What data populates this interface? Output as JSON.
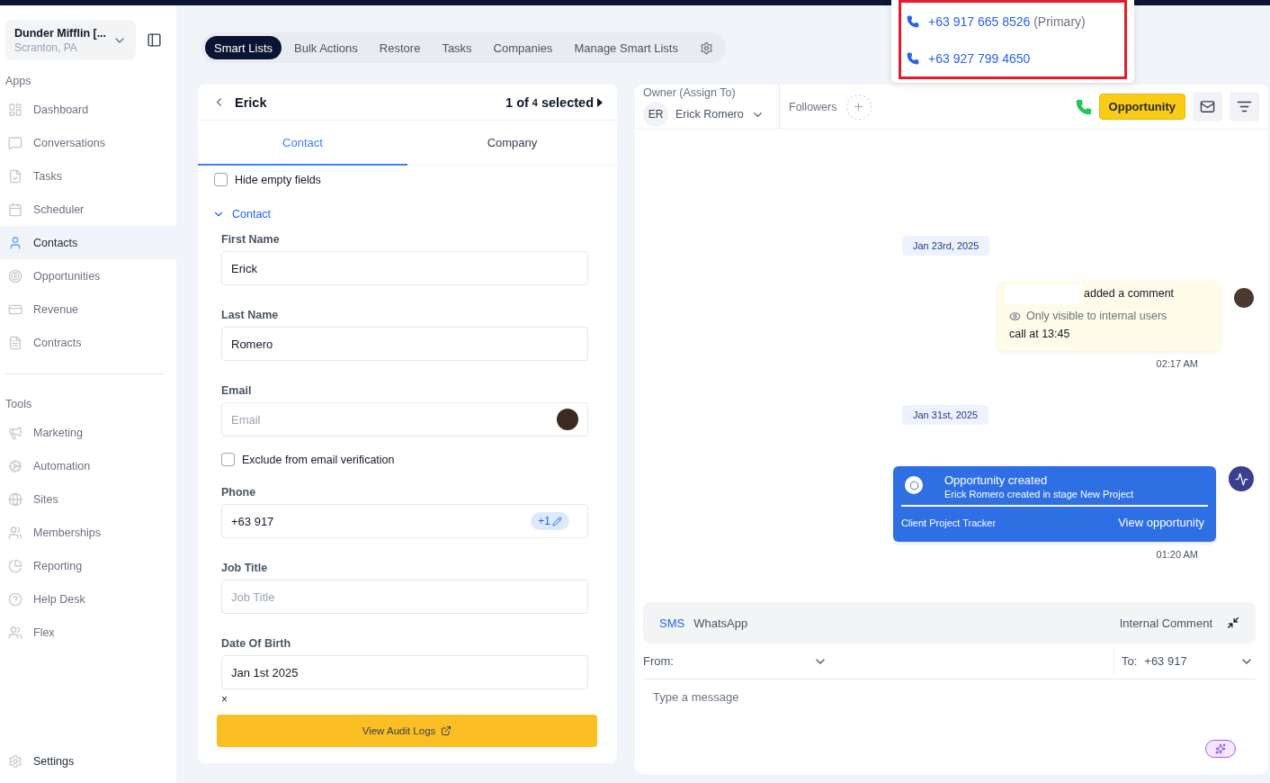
{
  "workspace": {
    "name": "Dunder Mifflin [...",
    "location": "Scranton, PA"
  },
  "sidebar": {
    "sections": [
      {
        "title": "Apps",
        "items": [
          {
            "label": "Dashboard",
            "selected": false
          },
          {
            "label": "Conversations",
            "selected": false
          },
          {
            "label": "Tasks",
            "selected": false
          },
          {
            "label": "Scheduler",
            "selected": false
          },
          {
            "label": "Contacts",
            "selected": true
          },
          {
            "label": "Opportunities",
            "selected": false
          },
          {
            "label": "Revenue",
            "selected": false
          },
          {
            "label": "Contracts",
            "selected": false
          }
        ]
      },
      {
        "title": "Tools",
        "items": [
          {
            "label": "Marketing",
            "selected": false
          },
          {
            "label": "Automation",
            "selected": false
          },
          {
            "label": "Sites",
            "selected": false
          },
          {
            "label": "Memberships",
            "selected": false
          },
          {
            "label": "Reporting",
            "selected": false
          },
          {
            "label": "Help Desk",
            "selected": false
          },
          {
            "label": "Flex",
            "selected": false
          }
        ]
      }
    ],
    "settings": "Settings"
  },
  "nav_tabs": [
    {
      "label": "Smart Lists",
      "selected": true
    },
    {
      "label": "Bulk Actions",
      "selected": false
    },
    {
      "label": "Restore",
      "selected": false
    },
    {
      "label": "Tasks",
      "selected": false
    },
    {
      "label": "Companies",
      "selected": false
    },
    {
      "label": "Manage Smart Lists",
      "selected": false
    }
  ],
  "contact_panel": {
    "name": "Erick",
    "pager": {
      "current": "1 of",
      "total": "4",
      "suffix": "selected"
    },
    "tabs": [
      {
        "label": "Contact",
        "selected": true
      },
      {
        "label": "Company",
        "selected": false
      }
    ],
    "hide_empty": {
      "label": "Hide empty fields",
      "checked": false
    },
    "section": {
      "title": "Contact",
      "expanded": true
    },
    "fields": [
      {
        "kind": "input",
        "label": "First Name",
        "value": "Erick"
      },
      {
        "kind": "input",
        "label": "Last Name",
        "value": "Romero"
      },
      {
        "kind": "email",
        "label": "Email",
        "placeholder": "Email"
      },
      {
        "kind": "checkbox",
        "label": "Exclude from email verification",
        "checked": false
      },
      {
        "kind": "phone",
        "label": "Phone",
        "value": "+63 917",
        "badge": "+1"
      },
      {
        "kind": "input",
        "label": "Job Title",
        "placeholder": "Job Title"
      },
      {
        "kind": "date",
        "label": "Date Of Birth",
        "value": "Jan 1st 2025",
        "clear": "×"
      }
    ],
    "audit_button": "View Audit Logs"
  },
  "conversation": {
    "owner": {
      "label": "Owner (Assign To)",
      "initials": "ER",
      "name": "Erick Romero"
    },
    "followers": "Followers",
    "opportunity_button": "Opportunity",
    "timeline": [
      {
        "kind": "date",
        "text": "Jan 23rd, 2025"
      },
      {
        "kind": "comment",
        "action": "added a comment",
        "visibility": "Only visible to internal users",
        "body": "call at 13:45",
        "time": "02:17 AM"
      },
      {
        "kind": "date",
        "text": "Jan 31st, 2025"
      },
      {
        "kind": "event",
        "title": "Opportunity created",
        "subtitle": "Erick Romero created in stage New Project",
        "pipeline": "Client Project Tracker",
        "link": "View opportunity",
        "time": "01:20 AM"
      }
    ],
    "composer": {
      "channels": [
        {
          "label": "SMS",
          "selected": true
        },
        {
          "label": "WhatsApp",
          "selected": false
        }
      ],
      "internal": "Internal Comment",
      "from_label": "From:",
      "to_label": "To:",
      "to_value": "+63 917",
      "placeholder": "Type a message"
    }
  },
  "phone_popup": [
    {
      "number": "+63 917 665 8526",
      "tag": "(Primary)"
    },
    {
      "number": "+63 927 799 4650"
    }
  ]
}
